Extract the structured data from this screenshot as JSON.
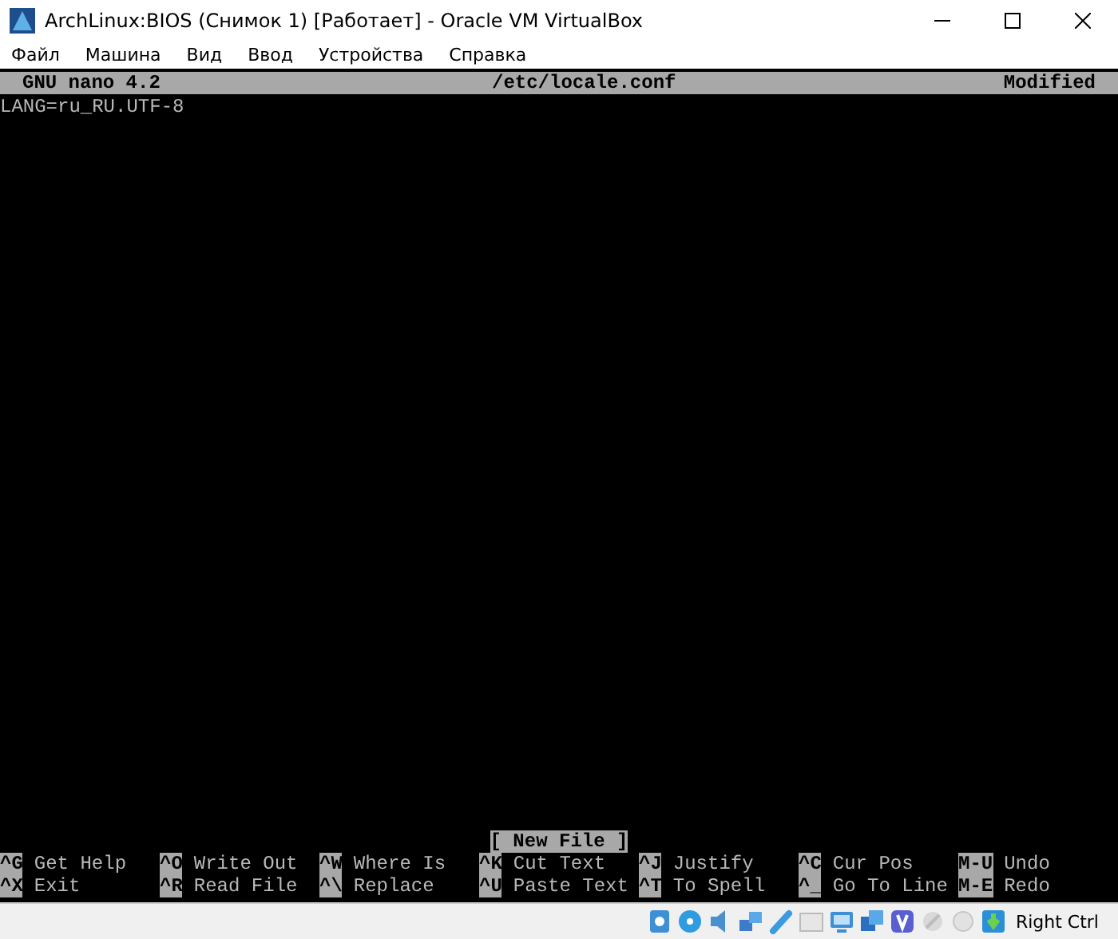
{
  "window": {
    "title": "ArchLinux:BIOS (Снимок 1) [Работает] - Oracle VM VirtualBox"
  },
  "menu": [
    "Файл",
    "Машина",
    "Вид",
    "Ввод",
    "Устройства",
    "Справка"
  ],
  "nano": {
    "header": {
      "version": "GNU nano 4.2",
      "file": "/etc/locale.conf",
      "state": "Modified"
    },
    "lines": [
      "LANG=ru_RU.UTF-8"
    ],
    "message": "[ New File ]",
    "shortcuts": [
      [
        {
          "key": "^G",
          "label": "Get Help"
        },
        {
          "key": "^X",
          "label": "Exit"
        }
      ],
      [
        {
          "key": "^O",
          "label": "Write Out"
        },
        {
          "key": "^R",
          "label": "Read File"
        }
      ],
      [
        {
          "key": "^W",
          "label": "Where Is"
        },
        {
          "key": "^\\",
          "label": "Replace"
        }
      ],
      [
        {
          "key": "^K",
          "label": "Cut Text"
        },
        {
          "key": "^U",
          "label": "Paste Text"
        }
      ],
      [
        {
          "key": "^J",
          "label": "Justify"
        },
        {
          "key": "^T",
          "label": "To Spell"
        }
      ],
      [
        {
          "key": "^C",
          "label": "Cur Pos"
        },
        {
          "key": "^_",
          "label": "Go To Line"
        }
      ],
      [
        {
          "key": "M-U",
          "label": "Undo"
        },
        {
          "key": "M-E",
          "label": "Redo"
        }
      ]
    ]
  },
  "status_bar": {
    "host_key": "Right Ctrl"
  }
}
